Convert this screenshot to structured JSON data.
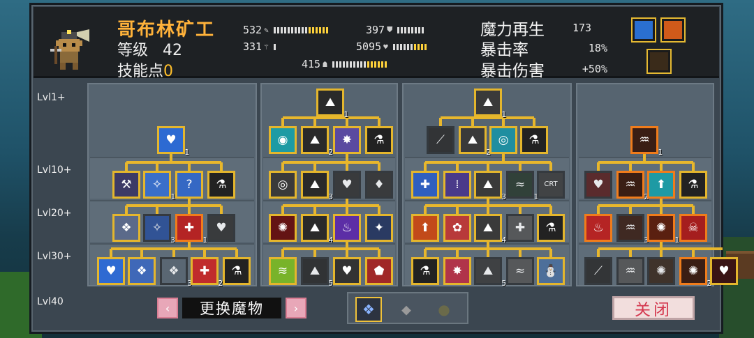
{
  "hero": {
    "name": "哥布林矿工",
    "level_label": "等级",
    "level": "42",
    "skill_points_label": "技能点",
    "skill_points": "0"
  },
  "stats": {
    "attack": "532",
    "defense": "397",
    "magic_attack": "331",
    "health": "5095",
    "speed": "415"
  },
  "right_stats": {
    "mana_regen_label": "魔力再生",
    "mana_regen": "173",
    "crit_rate_label": "暴击率",
    "crit_rate": "18%",
    "crit_damage_label": "暴击伤害",
    "crit_damage": "+50%"
  },
  "levels": [
    "Lvl1+",
    "Lvl10+",
    "Lvl20+",
    "Lvl30+",
    "Lvl40"
  ],
  "trees": [
    {
      "nodes": [
        {
          "glyph": "♥",
          "count": "1",
          "border": "gold",
          "bg": "#2d6ad2"
        },
        {
          "glyph": "⚒",
          "count": "",
          "border": "gold",
          "bg": "#3d3a66"
        },
        {
          "glyph": "✧",
          "count": "1",
          "border": "gold",
          "bg": "#3a6fc9"
        },
        {
          "glyph": "?",
          "count": "",
          "border": "gold",
          "bg": "#3568c4"
        },
        {
          "glyph": "⚗",
          "count": "",
          "border": "gold",
          "bg": "#222"
        },
        {
          "glyph": "❖",
          "count": "",
          "border": "gold",
          "bg": "#5b6a8a"
        },
        {
          "glyph": "✧",
          "count": "3",
          "border": "locked",
          "bg": "#2a4f9a"
        },
        {
          "glyph": "✚",
          "count": "1",
          "border": "orange",
          "bg": "#b42424"
        },
        {
          "glyph": "♥",
          "count": "",
          "border": "locked",
          "bg": "#333"
        },
        {
          "glyph": "♥",
          "count": "",
          "border": "gold",
          "bg": "#2f6ad2"
        },
        {
          "glyph": "❖",
          "count": "",
          "border": "gold",
          "bg": "#3f68b8"
        },
        {
          "glyph": "❖",
          "count": "3",
          "border": "locked",
          "bg": "#5a6672"
        },
        {
          "glyph": "✚",
          "count": "2",
          "border": "gold",
          "bg": "#c02c2c"
        },
        {
          "glyph": "⚗",
          "count": "",
          "border": "gold",
          "bg": "#222"
        }
      ]
    },
    {
      "nodes": [
        {
          "glyph": "⛰",
          "count": "1",
          "border": "gold",
          "bg": "#2a2a2a"
        },
        {
          "glyph": "◉",
          "count": "",
          "border": "gold",
          "bg": "#1d9ba4"
        },
        {
          "glyph": "⛰",
          "count": "2",
          "border": "gold",
          "bg": "#2a2a2a"
        },
        {
          "glyph": "✸",
          "count": "",
          "border": "gold",
          "bg": "#5a4aa0"
        },
        {
          "glyph": "⚗",
          "count": "",
          "border": "gold",
          "bg": "#222"
        },
        {
          "glyph": "◎",
          "count": "",
          "border": "gold",
          "bg": "#3a3a3a"
        },
        {
          "glyph": "⛰",
          "count": "3",
          "border": "gold",
          "bg": "#2a2a2a"
        },
        {
          "glyph": "♥",
          "count": "",
          "border": "locked",
          "bg": "#333"
        },
        {
          "glyph": "♦",
          "count": "",
          "border": "locked",
          "bg": "#333"
        },
        {
          "glyph": "✺",
          "count": "",
          "border": "gold",
          "bg": "#641414"
        },
        {
          "glyph": "⛰",
          "count": "4",
          "border": "gold",
          "bg": "#2a2a2a"
        },
        {
          "glyph": "♨",
          "count": "",
          "border": "gold",
          "bg": "#5c2ea6"
        },
        {
          "glyph": "✦",
          "count": "",
          "border": "gold",
          "bg": "#2a3a62"
        },
        {
          "glyph": "≋",
          "count": "",
          "border": "gold",
          "bg": "#78b32a"
        },
        {
          "glyph": "⛰",
          "count": "5",
          "border": "locked",
          "bg": "#2a2a2a"
        },
        {
          "glyph": "♥",
          "count": "",
          "border": "gold",
          "bg": "#333"
        },
        {
          "glyph": "⬟",
          "count": "",
          "border": "gold",
          "bg": "#a02828"
        }
      ]
    },
    {
      "nodes": [
        {
          "glyph": "⛰",
          "count": "1",
          "border": "gold",
          "bg": "#3a3a3a"
        },
        {
          "glyph": "⟋",
          "count": "",
          "border": "locked",
          "bg": "#2c2c2c"
        },
        {
          "glyph": "⛰",
          "count": "2",
          "border": "gold",
          "bg": "#3a3a3a"
        },
        {
          "glyph": "◎",
          "count": "",
          "border": "gold",
          "bg": "#1f8ea0"
        },
        {
          "glyph": "⚗",
          "count": "",
          "border": "gold",
          "bg": "#222"
        },
        {
          "glyph": "✚",
          "count": "",
          "border": "gold",
          "bg": "#2f5fbf"
        },
        {
          "glyph": "⁞",
          "count": "",
          "border": "gold",
          "bg": "#4a3a8a"
        },
        {
          "glyph": "⛰",
          "count": "3",
          "border": "gold",
          "bg": "#3a3a3a"
        },
        {
          "glyph": "≈",
          "count": "1",
          "border": "locked",
          "bg": "#2a3a2e"
        },
        {
          "glyph": "CRT",
          "count": "",
          "border": "locked",
          "bg": "#3c3c3c"
        },
        {
          "glyph": "⬆",
          "count": "",
          "border": "gold",
          "bg": "#c24a1a"
        },
        {
          "glyph": "✿",
          "count": "",
          "border": "gold",
          "bg": "#b83a3a"
        },
        {
          "glyph": "⛰",
          "count": "4",
          "border": "gold",
          "bg": "#3a3a3a"
        },
        {
          "glyph": "✚",
          "count": "",
          "border": "locked",
          "bg": "#555"
        },
        {
          "glyph": "⚗",
          "count": "",
          "border": "gold",
          "bg": "#222"
        },
        {
          "glyph": "⚗",
          "count": "",
          "border": "gold",
          "bg": "#222"
        },
        {
          "glyph": "✸",
          "count": "",
          "border": "gold",
          "bg": "#b0344a"
        },
        {
          "glyph": "⛰",
          "count": "5",
          "border": "locked",
          "bg": "#3a3a3a"
        },
        {
          "glyph": "≈",
          "count": "",
          "border": "locked",
          "bg": "#555"
        },
        {
          "glyph": "⛄",
          "count": "",
          "border": "gold",
          "bg": "#4d6f9a"
        }
      ]
    },
    {
      "nodes": [
        {
          "glyph": "♒",
          "count": "1",
          "border": "orange",
          "bg": "#3a1e14"
        },
        {
          "glyph": "♥",
          "count": "",
          "border": "locked",
          "bg": "#5a2020"
        },
        {
          "glyph": "♒",
          "count": "2",
          "border": "orange",
          "bg": "#3a1e14"
        },
        {
          "glyph": "⬆",
          "count": "",
          "border": "orange",
          "bg": "#1e9aa4"
        },
        {
          "glyph": "⚗",
          "count": "",
          "border": "gold",
          "bg": "#222"
        },
        {
          "glyph": "♨",
          "count": "",
          "border": "orange",
          "bg": "#b52424"
        },
        {
          "glyph": "♒",
          "count": "3",
          "border": "locked",
          "bg": "#3a1e14"
        },
        {
          "glyph": "✺",
          "count": "1",
          "border": "orange",
          "bg": "#5a2010"
        },
        {
          "glyph": "☠",
          "count": "",
          "border": "orange",
          "bg": "#a51e1e"
        },
        {
          "glyph": "⟋",
          "count": "",
          "border": "locked",
          "bg": "#2c2c2c"
        },
        {
          "glyph": "♒",
          "count": "",
          "border": "locked",
          "bg": "#555"
        },
        {
          "glyph": "✺",
          "count": "",
          "border": "locked",
          "bg": "#3a2a1e"
        },
        {
          "glyph": "✺",
          "count": "2",
          "border": "orange",
          "bg": "#3a1e14"
        },
        {
          "glyph": "♥",
          "count": "",
          "border": "gold",
          "bg": "#3a1414"
        }
      ]
    }
  ],
  "footer": {
    "prev": "‹",
    "next": "›",
    "swap_label": "更换魔物",
    "close_label": "关闭",
    "tab_icons": [
      "❖",
      "⬥",
      "●"
    ]
  },
  "colors": {
    "accent": "#e4b62d",
    "hero_name": "#ffb23a",
    "skill_points": "#ffbf2b",
    "close_text": "#d4384f"
  }
}
